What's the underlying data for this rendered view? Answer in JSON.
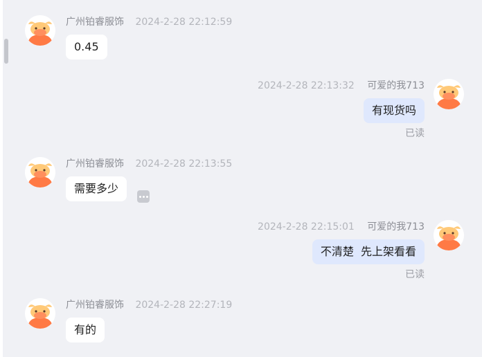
{
  "messages": [
    {
      "direction": "in",
      "sender": "广州铂睿服饰",
      "time": "2024-2-28 22:12:59",
      "text": "0.45"
    },
    {
      "direction": "out",
      "sender": "可爱的我713",
      "time": "2024-2-28 22:13:32",
      "text": "有现货吗",
      "status": "已读"
    },
    {
      "direction": "in",
      "sender": "广州铂睿服饰",
      "time": "2024-2-28 22:13:55",
      "text": "需要多少"
    },
    {
      "direction": "out",
      "sender": "可爱的我713",
      "time": "2024-2-28 22:15:01",
      "text": "不清楚  先上架看看",
      "status": "已读"
    },
    {
      "direction": "in",
      "sender": "广州铂睿服饰",
      "time": "2024-2-28 22:27:19",
      "text": "有的"
    }
  ],
  "icons": {
    "avatar": "bull-avatar-icon",
    "more": "more-options-icon"
  },
  "colors": {
    "background": "#f0f1f5",
    "incoming_bubble": "#ffffff",
    "outgoing_bubble": "#dfe8fd",
    "avatar_orange": "#ff7a45",
    "avatar_horn": "#ffc978"
  }
}
